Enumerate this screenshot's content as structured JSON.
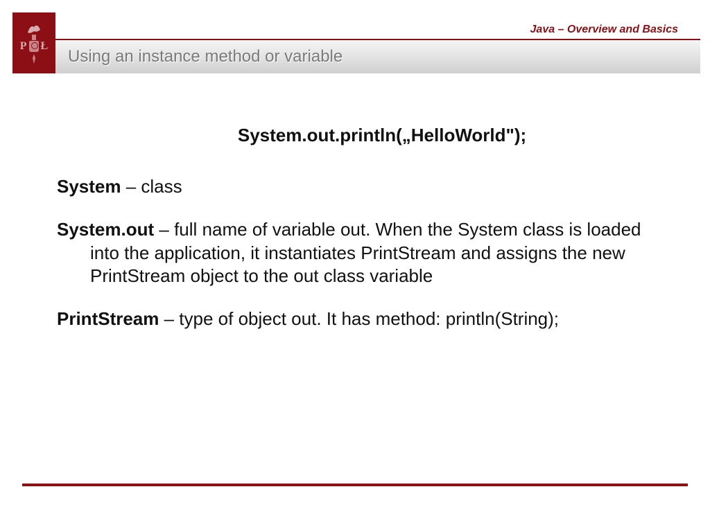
{
  "course_label": "Java – Overview and Basics",
  "slide_title": "Using an instance method or variable",
  "headline": "System.out.println(„HelloWorld\");",
  "entries": [
    {
      "term": "System",
      "desc": " – class"
    },
    {
      "term": "System.out",
      "desc": " – full name of variable out. When the System class is loaded into the application, it instantiates PrintStream and assigns the new PrintStream object to the out class variable"
    },
    {
      "term": "PrintStream",
      "desc": " – type of object out. It has method: println(String);"
    }
  ]
}
